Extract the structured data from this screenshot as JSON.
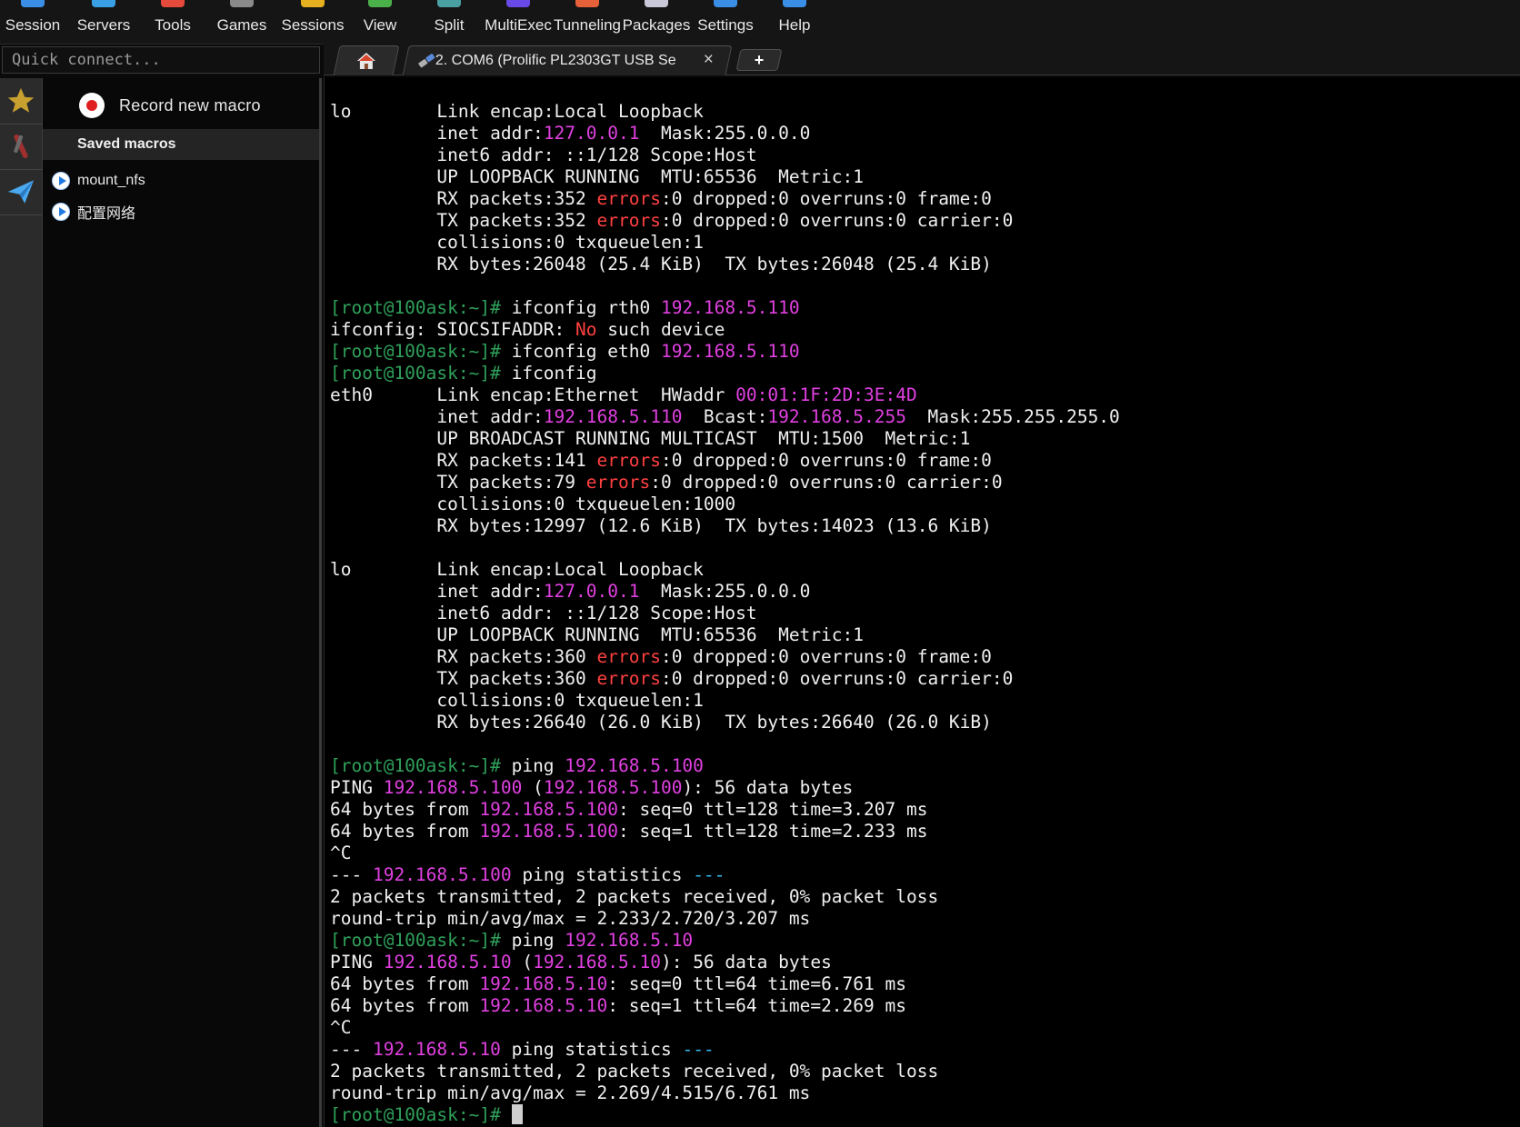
{
  "toolbar": {
    "items": [
      {
        "label": "Session",
        "icon": "monitor-icon",
        "color": "#3a8ee6"
      },
      {
        "label": "Servers",
        "icon": "network-icon",
        "color": "#3aa0e6"
      },
      {
        "label": "Tools",
        "icon": "tools-icon",
        "color": "#e64a3a"
      },
      {
        "label": "Games",
        "icon": "gamepad-icon",
        "color": "#8a8a8a"
      },
      {
        "label": "Sessions",
        "icon": "star-icon",
        "color": "#e6b020"
      },
      {
        "label": "View",
        "icon": "view-icon",
        "color": "#4ab04a"
      },
      {
        "label": "Split",
        "icon": "split-icon",
        "color": "#4aa0a0"
      },
      {
        "label": "MultiExec",
        "icon": "multiexec-icon",
        "color": "#6a4ae6"
      },
      {
        "label": "Tunneling",
        "icon": "tunnel-icon",
        "color": "#e6603a"
      },
      {
        "label": "Packages",
        "icon": "packages-icon",
        "color": "#c8c8d8"
      },
      {
        "label": "Settings",
        "icon": "gear-icon",
        "color": "#3a8ee6"
      },
      {
        "label": "Help",
        "icon": "help-icon",
        "color": "#3a8ee6"
      }
    ]
  },
  "quick_connect": {
    "placeholder": "Quick connect..."
  },
  "tabs": {
    "session_label": "2. COM6  (Prolific PL2303GT USB Se",
    "close_glyph": "×",
    "new_tab_glyph": "+"
  },
  "macros": {
    "record_label": "Record new macro",
    "saved_header": "Saved macros",
    "items": [
      "mount_nfs",
      "配置网络"
    ]
  },
  "terminal": {
    "prompt": "[root@100ask:~]#",
    "lines": [
      [
        [
          "lo        Link encap:Local Loopback",
          ""
        ]
      ],
      [
        [
          "          inet addr:",
          ""
        ],
        [
          "127.0.0.1",
          "ip"
        ],
        [
          "  Mask:255.0.0.0",
          ""
        ]
      ],
      [
        [
          "          inet6 addr: ::1/128 Scope:Host",
          ""
        ]
      ],
      [
        [
          "          UP LOOPBACK RUNNING  MTU:65536  Metric:1",
          ""
        ]
      ],
      [
        [
          "          RX packets:352 ",
          ""
        ],
        [
          "errors",
          "red"
        ],
        [
          ":0 dropped:0 overruns:0 frame:0",
          ""
        ]
      ],
      [
        [
          "          TX packets:352 ",
          ""
        ],
        [
          "errors",
          "red"
        ],
        [
          ":0 dropped:0 overruns:0 carrier:0",
          ""
        ]
      ],
      [
        [
          "          collisions:0 txqueuelen:1",
          ""
        ]
      ],
      [
        [
          "          RX bytes:26048 (25.4 KiB)  TX bytes:26048 (25.4 KiB)",
          ""
        ]
      ],
      [
        [
          "",
          ""
        ]
      ],
      [
        [
          "[root@100ask:~]#",
          "prompt"
        ],
        [
          " ifconfig rth0 ",
          ""
        ],
        [
          "192.168.5.110",
          "ip"
        ]
      ],
      [
        [
          "ifconfig: SIOCSIFADDR: ",
          ""
        ],
        [
          "No",
          "red"
        ],
        [
          " such device",
          ""
        ]
      ],
      [
        [
          "[root@100ask:~]#",
          "prompt"
        ],
        [
          " ifconfig eth0 ",
          ""
        ],
        [
          "192.168.5.110",
          "ip"
        ]
      ],
      [
        [
          "[root@100ask:~]#",
          "prompt"
        ],
        [
          " ifconfig",
          ""
        ]
      ],
      [
        [
          "eth0      Link encap:Ethernet  HWaddr ",
          ""
        ],
        [
          "00:01:1F:2D:3E:4D",
          "ip"
        ]
      ],
      [
        [
          "          inet addr:",
          ""
        ],
        [
          "192.168.5.110",
          "ip"
        ],
        [
          "  Bcast:",
          ""
        ],
        [
          "192.168.5.255",
          "ip"
        ],
        [
          "  Mask:255.255.255.0",
          ""
        ]
      ],
      [
        [
          "          UP BROADCAST RUNNING MULTICAST  MTU:1500  Metric:1",
          ""
        ]
      ],
      [
        [
          "          RX packets:141 ",
          ""
        ],
        [
          "errors",
          "red"
        ],
        [
          ":0 dropped:0 overruns:0 frame:0",
          ""
        ]
      ],
      [
        [
          "          TX packets:79 ",
          ""
        ],
        [
          "errors",
          "red"
        ],
        [
          ":0 dropped:0 overruns:0 carrier:0",
          ""
        ]
      ],
      [
        [
          "          collisions:0 txqueuelen:1000",
          ""
        ]
      ],
      [
        [
          "          RX bytes:12997 (12.6 KiB)  TX bytes:14023 (13.6 KiB)",
          ""
        ]
      ],
      [
        [
          "",
          ""
        ]
      ],
      [
        [
          "lo        Link encap:Local Loopback",
          ""
        ]
      ],
      [
        [
          "          inet addr:",
          ""
        ],
        [
          "127.0.0.1",
          "ip"
        ],
        [
          "  Mask:255.0.0.0",
          ""
        ]
      ],
      [
        [
          "          inet6 addr: ::1/128 Scope:Host",
          ""
        ]
      ],
      [
        [
          "          UP LOOPBACK RUNNING  MTU:65536  Metric:1",
          ""
        ]
      ],
      [
        [
          "          RX packets:360 ",
          ""
        ],
        [
          "errors",
          "red"
        ],
        [
          ":0 dropped:0 overruns:0 frame:0",
          ""
        ]
      ],
      [
        [
          "          TX packets:360 ",
          ""
        ],
        [
          "errors",
          "red"
        ],
        [
          ":0 dropped:0 overruns:0 carrier:0",
          ""
        ]
      ],
      [
        [
          "          collisions:0 txqueuelen:1",
          ""
        ]
      ],
      [
        [
          "          RX bytes:26640 (26.0 KiB)  TX bytes:26640 (26.0 KiB)",
          ""
        ]
      ],
      [
        [
          "",
          ""
        ]
      ],
      [
        [
          "[root@100ask:~]#",
          "prompt"
        ],
        [
          " ping ",
          ""
        ],
        [
          "192.168.5.100",
          "ip"
        ]
      ],
      [
        [
          "PING ",
          ""
        ],
        [
          "192.168.5.100",
          "ip"
        ],
        [
          " (",
          ""
        ],
        [
          "192.168.5.100",
          "ip"
        ],
        [
          "): 56 data bytes",
          ""
        ]
      ],
      [
        [
          "64 bytes from ",
          ""
        ],
        [
          "192.168.5.100",
          "ip"
        ],
        [
          ": seq=0 ttl=128 time=3.207 ms",
          ""
        ]
      ],
      [
        [
          "64 bytes from ",
          ""
        ],
        [
          "192.168.5.100",
          "ip"
        ],
        [
          ": seq=1 ttl=128 time=2.233 ms",
          ""
        ]
      ],
      [
        [
          "^C",
          ""
        ]
      ],
      [
        [
          "--- ",
          ""
        ],
        [
          "192.168.5.100",
          "ip"
        ],
        [
          " ping statistics ",
          ""
        ],
        [
          "---",
          "cyan"
        ]
      ],
      [
        [
          "2 packets transmitted, 2 packets received, 0% packet loss",
          ""
        ]
      ],
      [
        [
          "round-trip min/avg/max = 2.233/2.720/3.207 ms",
          ""
        ]
      ],
      [
        [
          "[root@100ask:~]#",
          "prompt"
        ],
        [
          " ping ",
          ""
        ],
        [
          "192.168.5.10",
          "ip"
        ]
      ],
      [
        [
          "PING ",
          ""
        ],
        [
          "192.168.5.10",
          "ip"
        ],
        [
          " (",
          ""
        ],
        [
          "192.168.5.10",
          "ip"
        ],
        [
          "): 56 data bytes",
          ""
        ]
      ],
      [
        [
          "64 bytes from ",
          ""
        ],
        [
          "192.168.5.10",
          "ip"
        ],
        [
          ": seq=0 ttl=64 time=6.761 ms",
          ""
        ]
      ],
      [
        [
          "64 bytes from ",
          ""
        ],
        [
          "192.168.5.10",
          "ip"
        ],
        [
          ": seq=1 ttl=64 time=2.269 ms",
          ""
        ]
      ],
      [
        [
          "^C",
          ""
        ]
      ],
      [
        [
          "--- ",
          ""
        ],
        [
          "192.168.5.10",
          "ip"
        ],
        [
          " ping statistics ",
          ""
        ],
        [
          "---",
          "cyan"
        ]
      ],
      [
        [
          "2 packets transmitted, 2 packets received, 0% packet loss",
          ""
        ]
      ],
      [
        [
          "round-trip min/avg/max = 2.269/4.515/6.761 ms",
          ""
        ]
      ],
      [
        [
          "[root@100ask:~]#",
          "prompt"
        ],
        [
          " ",
          ""
        ],
        [
          "",
          "cursor"
        ]
      ]
    ]
  },
  "colors": {
    "ip": "#e040e0",
    "error": "#ff4040",
    "prompt": "#2fa05a",
    "cyan": "#33bbee",
    "background": "#000000"
  }
}
